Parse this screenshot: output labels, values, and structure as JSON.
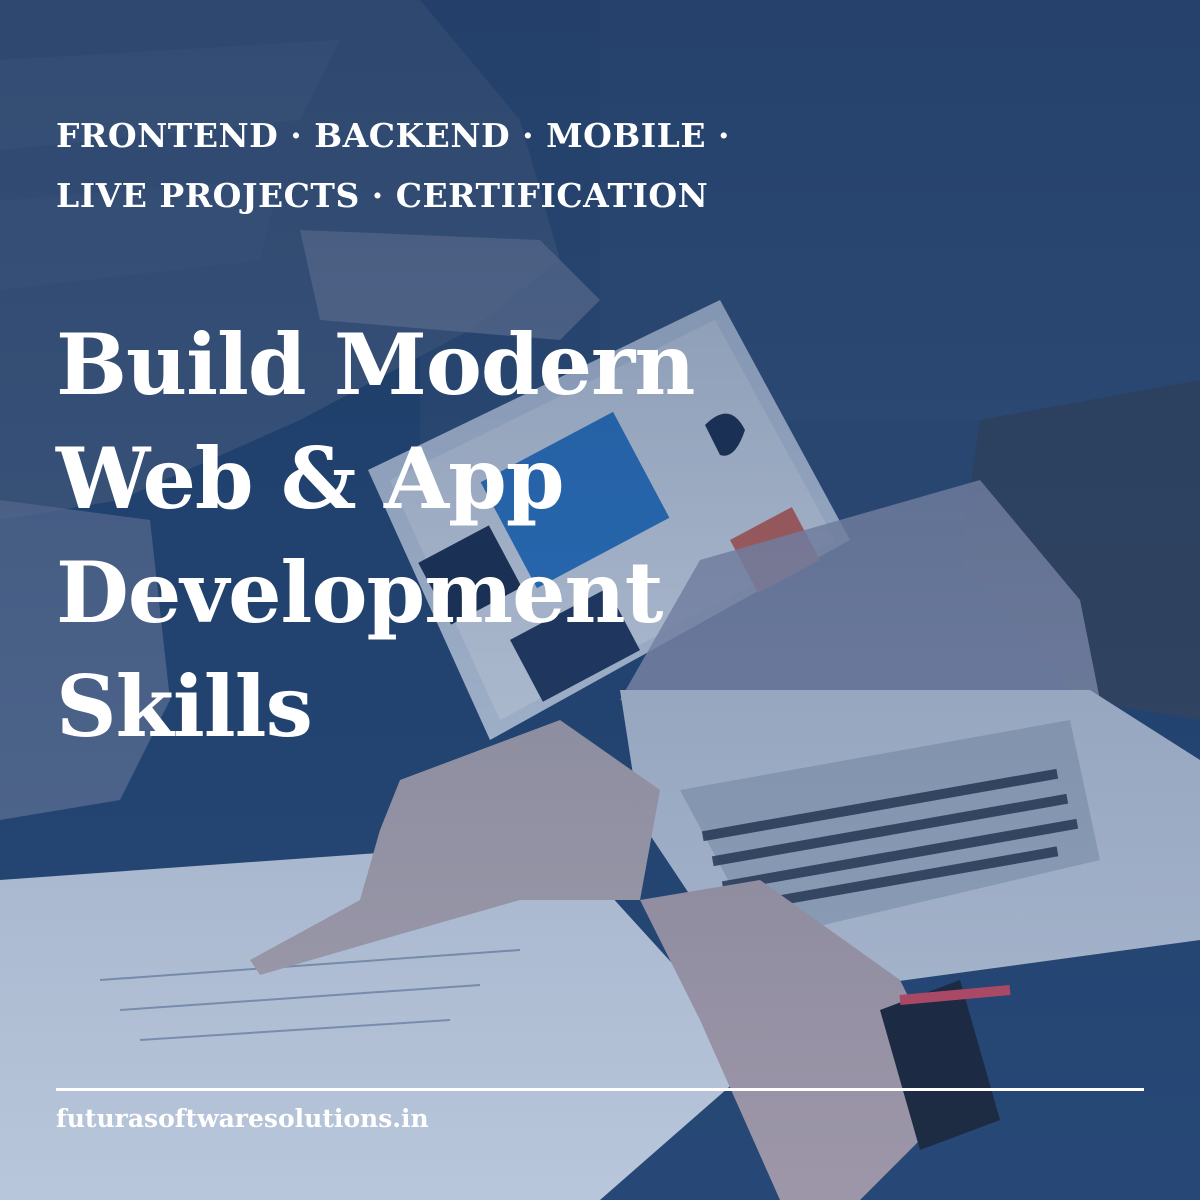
{
  "tagline": {
    "line1": "FRONTEND · BACKEND · MOBILE ·",
    "line2": "LIVE PROJECTS · CERTIFICATION"
  },
  "headline": {
    "line1": "Build Modern",
    "line2": "Web & App",
    "line3": "Development",
    "line4": "Skills"
  },
  "footer": {
    "url": "futurasoftwaresolutions.in"
  },
  "colors": {
    "overlay": "#1f3f70",
    "text": "#ffffff"
  },
  "icons": {
    "background": "team-laptop-photo"
  }
}
